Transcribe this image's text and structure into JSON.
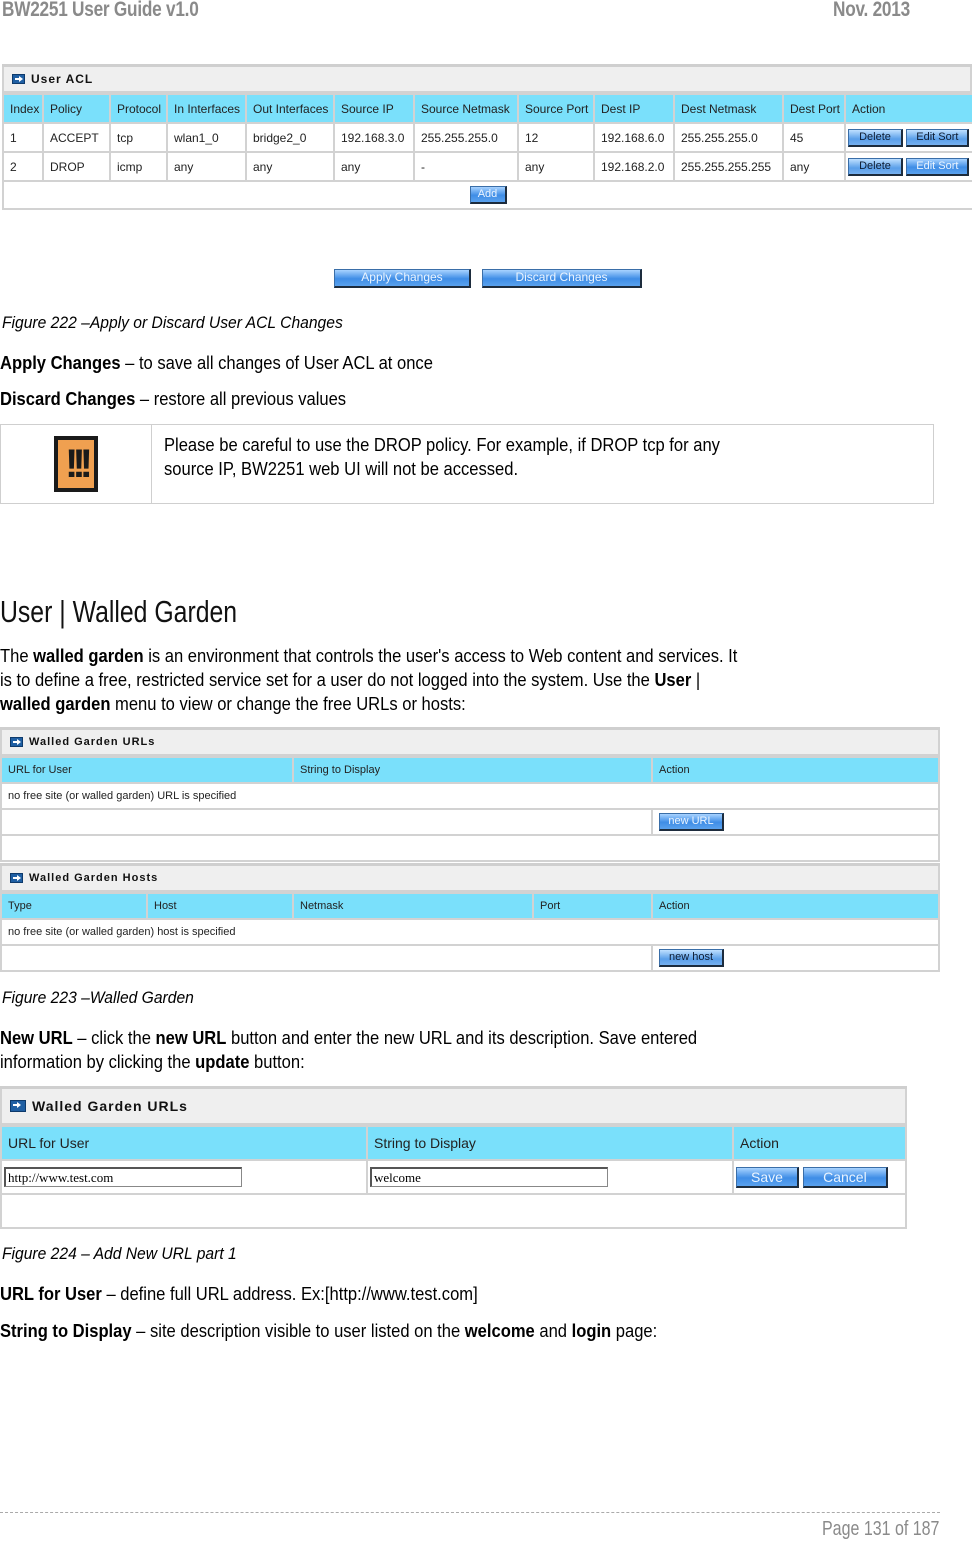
{
  "header": {
    "title": "BW2251 User Guide v1.0",
    "date": "Nov.  2013"
  },
  "user_acl": {
    "title": "User ACL",
    "columns": [
      "Index",
      "Policy",
      "Protocol",
      "In Interfaces",
      "Out Interfaces",
      "Source IP",
      "Source Netmask",
      "Source Port",
      "Dest IP",
      "Dest Netmask",
      "Dest Port",
      "Action"
    ],
    "rows": [
      {
        "index": "1",
        "policy": "ACCEPT",
        "protocol": "tcp",
        "in_if": "wlan1_0",
        "out_if": "bridge2_0",
        "src_ip": "192.168.3.0",
        "src_mask": "255.255.255.0",
        "src_port": "12",
        "dst_ip": "192.168.6.0",
        "dst_mask": "255.255.255.0",
        "dst_port": "45"
      },
      {
        "index": "2",
        "policy": "DROP",
        "protocol": "icmp",
        "in_if": "any",
        "out_if": "any",
        "src_ip": "any",
        "src_mask": "-",
        "src_port": "any",
        "dst_ip": "192.168.2.0",
        "dst_mask": "255.255.255.255",
        "dst_port": "any"
      }
    ],
    "delete_label": "Delete",
    "edit_sort_label": "Edit Sort",
    "add_label": "Add"
  },
  "apply_label": "Apply Changes",
  "discard_label": "Discard Changes",
  "fig222": "Figure 222 –Apply or Discard User ACL Changes",
  "apply_desc": {
    "term": "Apply Changes",
    "text": " – to save all changes of User ACL at once"
  },
  "discard_desc": {
    "term": "Discard Changes",
    "text": " – restore all previous values"
  },
  "note": {
    "icon": "warning-icon",
    "icon_glyph": "!!!",
    "line1": "Please be careful to use the DROP policy. For example, if DROP tcp for any",
    "line2": "source IP, BW2251 web UI will not be accessed."
  },
  "section_title": "User | Walled Garden",
  "intro": {
    "p1a": "The ",
    "p1b": "walled garden",
    "p1c": " is an environment that controls the user's access to Web content and services. It",
    "p2a": "is to define a free, restricted service set for a user do not logged into the system. Use the ",
    "p2b": "User",
    "p2c": " |",
    "p3a": "walled garden",
    "p3b": " menu to view or change the free URLs or hosts:"
  },
  "wg_urls": {
    "title": "Walled Garden URLs",
    "columns": [
      "URL for User",
      "String to Display",
      "Action"
    ],
    "empty": "no free site (or walled garden) URL is specified",
    "new_url_label": "new URL"
  },
  "wg_hosts": {
    "title": "Walled Garden Hosts",
    "columns": [
      "Type",
      "Host",
      "Netmask",
      "Port",
      "Action"
    ],
    "empty": "no free site (or walled garden) host is specified",
    "new_host_label": "new host"
  },
  "fig223": "Figure 223 –Walled Garden",
  "newurl_desc": {
    "a": "New URL",
    "b": " – click the ",
    "c": "new URL",
    "d": " button and enter the new URL and its description. Save entered",
    "e": "information by clicking the ",
    "f": "update",
    "g": " button:"
  },
  "add_url": {
    "title": "Walled Garden URLs",
    "columns": [
      "URL for User",
      "String to Display",
      "Action"
    ],
    "url_value": "http://www.test.com",
    "string_value": "welcome",
    "save_label": "Save",
    "cancel_label": "Cancel"
  },
  "fig224": "Figure 224 – Add New URL part 1",
  "url_desc": {
    "term": "URL for User",
    "text": " – define full URL address. Ex:[http://www.test.com]"
  },
  "string_desc": {
    "term": "String to Display",
    "a": " – site description visible to user listed on the ",
    "b": "welcome",
    "c": " and ",
    "d": "login",
    "e": " page:"
  },
  "footer": {
    "page": "Page 131 of 187"
  }
}
